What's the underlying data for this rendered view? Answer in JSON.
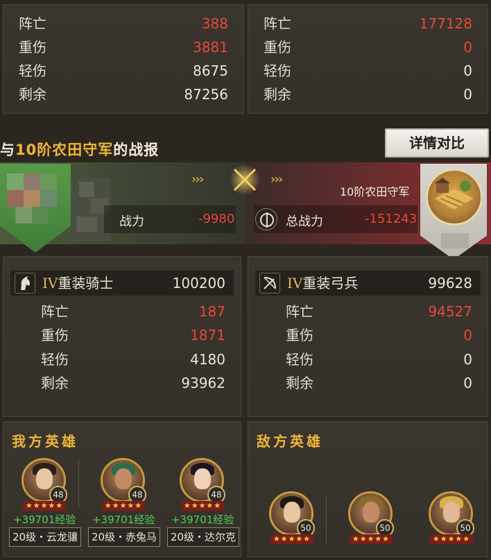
{
  "top_left": {
    "rows": [
      {
        "label": "阵亡",
        "value": "388",
        "red": true
      },
      {
        "label": "重伤",
        "value": "3881",
        "red": true
      },
      {
        "label": "轻伤",
        "value": "8675",
        "red": false
      },
      {
        "label": "剩余",
        "value": "87256",
        "red": false
      }
    ]
  },
  "top_right": {
    "rows": [
      {
        "label": "阵亡",
        "value": "177128",
        "red": true
      },
      {
        "label": "重伤",
        "value": "0",
        "red": true
      },
      {
        "label": "轻伤",
        "value": "0",
        "red": false
      },
      {
        "label": "剩余",
        "value": "0",
        "red": false
      }
    ]
  },
  "report": {
    "prefix": "与",
    "highlight": "10阶农田守军",
    "suffix": "的战报",
    "detail_button": "详情对比"
  },
  "battle": {
    "left_power_label": "战力",
    "left_power_value": "-9980",
    "right_name": "10阶农田守军",
    "right_power_label": "总战力",
    "right_power_value": "-151243",
    "left_arrows": "›››",
    "right_arrows": "›››"
  },
  "unit_left": {
    "icon": "knight-icon",
    "roman": "IV",
    "name": "重装骑士",
    "count": "100200",
    "rows": [
      {
        "label": "阵亡",
        "value": "187",
        "red": true
      },
      {
        "label": "重伤",
        "value": "1871",
        "red": true
      },
      {
        "label": "轻伤",
        "value": "4180",
        "red": false
      },
      {
        "label": "剩余",
        "value": "93962",
        "red": false
      }
    ]
  },
  "unit_right": {
    "icon": "bow-icon",
    "roman": "IV",
    "name": "重装弓兵",
    "count": "99628",
    "rows": [
      {
        "label": "阵亡",
        "value": "94527",
        "red": true
      },
      {
        "label": "重伤",
        "value": "0",
        "red": true
      },
      {
        "label": "轻伤",
        "value": "0",
        "red": false
      },
      {
        "label": "剩余",
        "value": "0",
        "red": false
      }
    ]
  },
  "heroes_left": {
    "title": "我方英雄",
    "items": [
      {
        "level": "48",
        "stars": "★★★★★",
        "exp": "+39701经验",
        "mount": "20级・云龙骧"
      },
      {
        "level": "48",
        "stars": "★★★★★",
        "exp": "+39701经验",
        "mount": "20级・赤兔马"
      },
      {
        "level": "48",
        "stars": "★★★★★",
        "exp": "+39701经验",
        "mount": "20级・达尔克"
      }
    ]
  },
  "heroes_right": {
    "title": "敌方英雄",
    "items": [
      {
        "level": "50",
        "stars": "★★★★★"
      },
      {
        "level": "50",
        "stars": "★★★★★"
      },
      {
        "level": "50",
        "stars": "★★★★★"
      }
    ]
  },
  "colors": {
    "accent_gold": "#f0b638",
    "loss_red": "#e8483a",
    "exp_green": "#4fd15a"
  }
}
